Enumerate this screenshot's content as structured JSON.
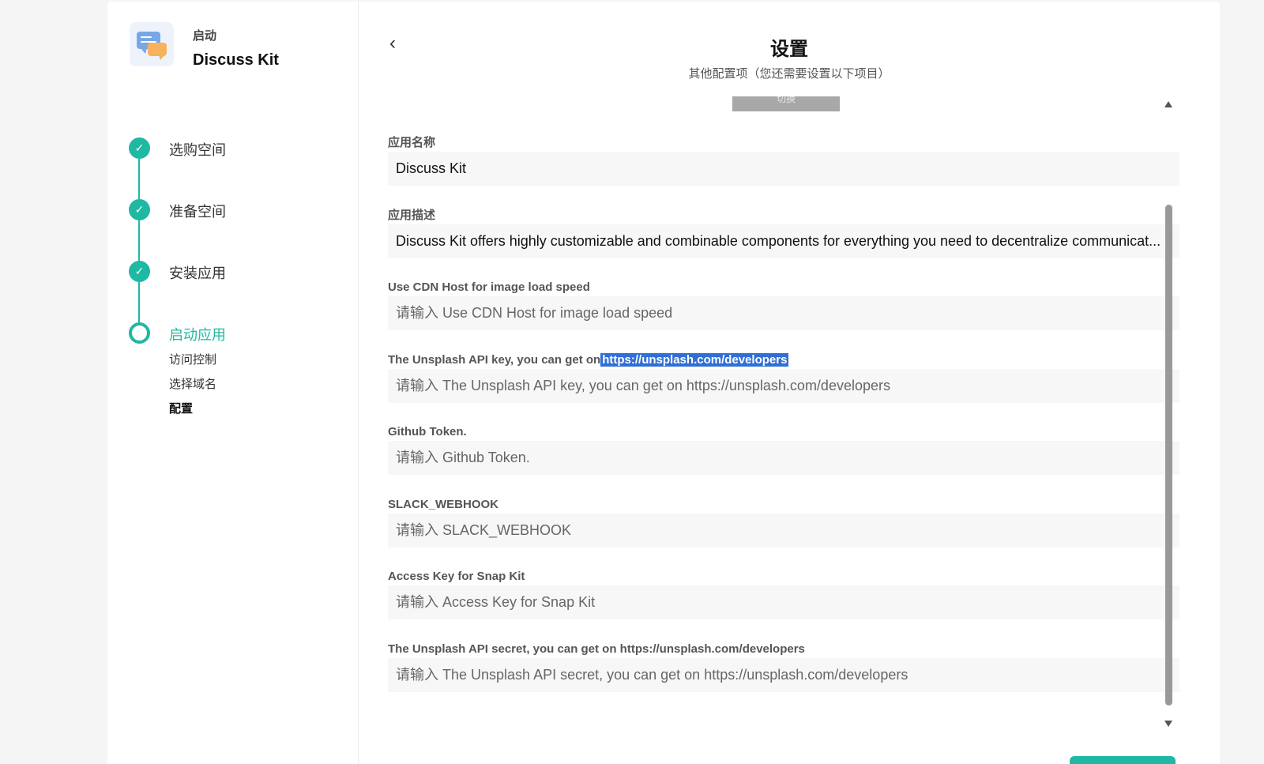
{
  "app": {
    "kicker": "启动",
    "name": "Discuss Kit"
  },
  "steps": [
    {
      "label": "选购空间",
      "status": "done"
    },
    {
      "label": "准备空间",
      "status": "done"
    },
    {
      "label": "安装应用",
      "status": "done"
    },
    {
      "label": "启动应用",
      "status": "current"
    }
  ],
  "substeps": [
    "访问控制",
    "选择域名",
    "配置"
  ],
  "header": {
    "title": "设置",
    "subtitle": "其他配置项（您还需要设置以下项目）",
    "switch_label": "切换"
  },
  "fields": [
    {
      "label": "应用名称",
      "value": "Discuss Kit",
      "placeholder": ""
    },
    {
      "label": "应用描述",
      "value": "Discuss Kit offers highly customizable and combinable components for everything you need to decentralize communicat...",
      "placeholder": ""
    },
    {
      "label": "Use CDN Host for image load speed",
      "value": "",
      "placeholder": "请输入 Use CDN Host for image load speed"
    },
    {
      "label_prefix": "The Unsplash API key, you can get on",
      "label_link": "https://unsplash.com/developers",
      "value": "",
      "placeholder": "请输入 The Unsplash API key, you can get on https://unsplash.com/developers"
    },
    {
      "label": "Github Token.",
      "value": "",
      "placeholder": "请输入 Github Token."
    },
    {
      "label": "SLACK_WEBHOOK",
      "value": "",
      "placeholder": "请输入 SLACK_WEBHOOK"
    },
    {
      "label": "Access Key for Snap Kit",
      "value": "",
      "placeholder": "请输入 Access Key for Snap Kit"
    },
    {
      "label": "The Unsplash API secret, you can get on https://unsplash.com/developers",
      "value": "",
      "placeholder": "请输入 The Unsplash API secret, you can get on https://unsplash.com/developers"
    }
  ],
  "colors": {
    "accent": "#1fb8a3",
    "link_highlight": "#2f6fd6"
  }
}
